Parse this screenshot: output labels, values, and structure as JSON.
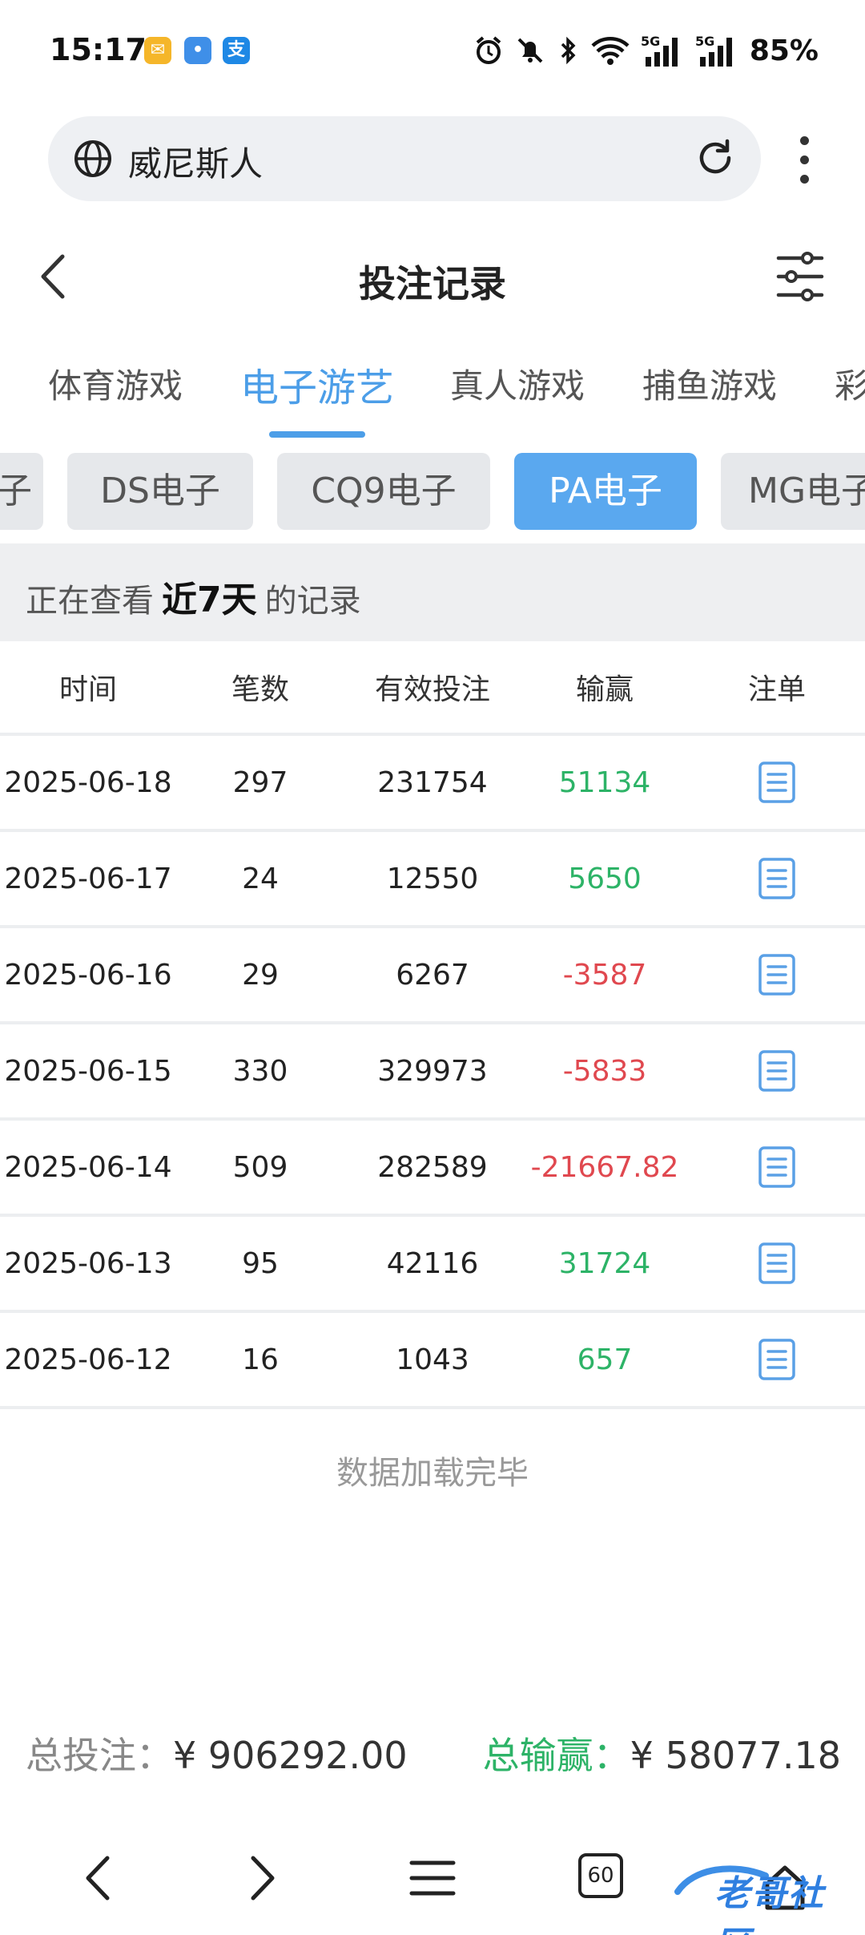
{
  "status_bar": {
    "time": "15:17",
    "app_icons": [
      {
        "name": "mail-app-icon",
        "color": "#f5b62a",
        "glyph": "✉"
      },
      {
        "name": "feather-app-icon",
        "color": "#3f8fe8",
        "glyph": "•"
      },
      {
        "name": "alipay-app-icon",
        "color": "#1e88e5",
        "glyph": "支"
      }
    ],
    "battery": "85%"
  },
  "address_bar": {
    "text": "威尼斯人"
  },
  "header": {
    "title": "投注记录"
  },
  "category_tabs": [
    {
      "label": "体育游戏",
      "active": false
    },
    {
      "label": "电子游艺",
      "active": true
    },
    {
      "label": "真人游戏",
      "active": false
    },
    {
      "label": "捕鱼游戏",
      "active": false
    },
    {
      "label": "彩",
      "active": false
    }
  ],
  "provider_chips": [
    {
      "label": "子",
      "active": false
    },
    {
      "label": "DS电子",
      "active": false
    },
    {
      "label": "CQ9电子",
      "active": false
    },
    {
      "label": "PA电子",
      "active": true
    },
    {
      "label": "MG电子",
      "active": false
    }
  ],
  "period": {
    "prefix": "正在查看",
    "range": "近7天",
    "suffix": "的记录"
  },
  "table": {
    "headers": [
      "时间",
      "笔数",
      "有效投注",
      "输赢",
      "注单"
    ],
    "rows": [
      {
        "date": "2025-06-18",
        "count": "297",
        "bet": "231754",
        "winloss": "51134",
        "positive": true
      },
      {
        "date": "2025-06-17",
        "count": "24",
        "bet": "12550",
        "winloss": "5650",
        "positive": true
      },
      {
        "date": "2025-06-16",
        "count": "29",
        "bet": "6267",
        "winloss": "-3587",
        "positive": false
      },
      {
        "date": "2025-06-15",
        "count": "330",
        "bet": "329973",
        "winloss": "-5833",
        "positive": false
      },
      {
        "date": "2025-06-14",
        "count": "509",
        "bet": "282589",
        "winloss": "-21667.82",
        "positive": false
      },
      {
        "date": "2025-06-13",
        "count": "95",
        "bet": "42116",
        "winloss": "31724",
        "positive": true
      },
      {
        "date": "2025-06-12",
        "count": "16",
        "bet": "1043",
        "winloss": "657",
        "positive": true
      }
    ]
  },
  "loaded_text": "数据加载完毕",
  "totals": {
    "bet_label": "总投注：",
    "bet_value": "¥ 906292.00",
    "win_label": "总输赢：",
    "win_value": "¥ 58077.18"
  },
  "bottom_nav": {
    "tab_count": "60"
  },
  "watermark": {
    "text": "老哥社区"
  },
  "colors": {
    "accent": "#4c9ee8",
    "win": "#2db367",
    "loss": "#e0484f"
  }
}
